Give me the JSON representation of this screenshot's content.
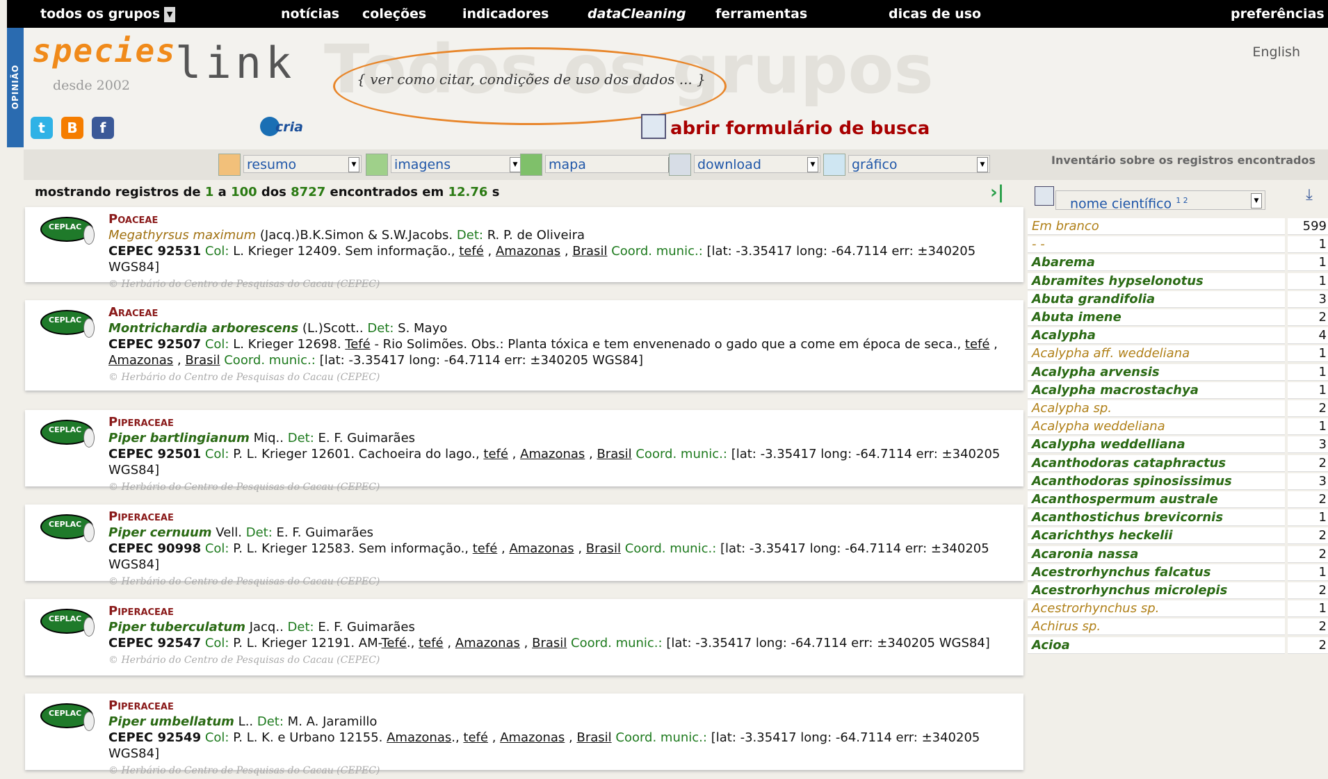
{
  "nav": {
    "group_select": "todos os grupos",
    "items": [
      "notícias",
      "coleções",
      "indicadores",
      "dataCleaning",
      "ferramentas",
      "dicas de uso",
      "preferências"
    ]
  },
  "side_tab": "OPINIÃO",
  "header": {
    "logo_species": "species",
    "logo_link": "link",
    "since": "desde 2002",
    "watermark": "Todos os grupos",
    "cite_link": "{ ver como citar, condições de uso dos dados ... }",
    "language": "English",
    "cria_label": "cria",
    "open_form": "abrir formulário de busca",
    "social": [
      "twitter-icon",
      "blogger-icon",
      "facebook-icon"
    ]
  },
  "toolbar": {
    "resumo": "resumo",
    "imagens": "imagens",
    "mapa": "mapa",
    "download": "download",
    "grafico": "gráfico",
    "inventory_title": "Inventário sobre os registros encontrados"
  },
  "summary": {
    "prefix": "mostrando registros de ",
    "from": "1",
    "sep1": " a ",
    "to": "100",
    "sep2": " dos ",
    "total": "8727",
    "sep3": " encontrados em ",
    "time": "12.76",
    "suffix": " s"
  },
  "records": [
    {
      "family": "Poaceae",
      "species": "Megathyrsus maximum",
      "species_light": true,
      "author": " (Jacq.)B.K.Simon & S.W.Jacobs.",
      "det": "R. P. de Oliveira",
      "catalog": "CEPEC 92531",
      "col_text": " L. Krieger 12409. Sem informação., ",
      "loc1": "tefé",
      "loc2": "Amazonas",
      "loc3": "Brasil",
      "coord": "[lat: -3.35417 long: -64.7114 err: ±340205 WGS84]",
      "credit": "© Herbário do Centro de Pesquisas do Cacau (CEPEC)"
    },
    {
      "family": "Araceae",
      "species": "Montrichardia arborescens",
      "species_light": false,
      "author": " (L.)Scott..",
      "det": "S. Mayo",
      "catalog": "CEPEC 92507",
      "col_text": " L. Krieger 12698. ",
      "col_u": "Tefé",
      "col_text2": " - Rio Solimões. Obs.: Planta tóxica e tem envenenado o gado que a come em época de seca., ",
      "loc1": "tefé",
      "loc2": "Amazonas",
      "loc3": "Brasil",
      "coord": "[lat: -3.35417 long: -64.7114 err: ±340205 WGS84]",
      "credit": "© Herbário do Centro de Pesquisas do Cacau (CEPEC)"
    },
    {
      "family": "Piperaceae",
      "species": "Piper bartlingianum",
      "species_light": false,
      "author": " Miq..",
      "det": "E. F. Guimarães",
      "catalog": "CEPEC 92501",
      "col_text": " P. L. Krieger 12601. Cachoeira do lago., ",
      "loc1": "tefé",
      "loc2": "Amazonas",
      "loc3": "Brasil",
      "coord": "[lat: -3.35417 long: -64.7114 err: ±340205 WGS84]",
      "credit": "© Herbário do Centro de Pesquisas do Cacau (CEPEC)"
    },
    {
      "family": "Piperaceae",
      "species": "Piper cernuum",
      "species_light": false,
      "author": " Vell.",
      "det": "E. F. Guimarães",
      "catalog": "CEPEC 90998",
      "col_text": " P. L. Krieger 12583. Sem informação., ",
      "loc1": "tefé",
      "loc2": "Amazonas",
      "loc3": "Brasil",
      "coord": "[lat: -3.35417 long: -64.7114 err: ±340205 WGS84]",
      "credit": "© Herbário do Centro de Pesquisas do Cacau (CEPEC)"
    },
    {
      "family": "Piperaceae",
      "species": "Piper tuberculatum",
      "species_light": false,
      "author": " Jacq..",
      "det": "E. F. Guimarães",
      "catalog": "CEPEC 92547",
      "col_text": " P. L. Krieger 12191. AM-",
      "col_u": "Tefé",
      "col_text2": "., ",
      "loc1": "tefé",
      "loc2": "Amazonas",
      "loc3": "Brasil",
      "coord": "[lat: -3.35417 long: -64.7114 err: ±340205 WGS84]",
      "credit": "© Herbário do Centro de Pesquisas do Cacau (CEPEC)"
    },
    {
      "family": "Piperaceae",
      "species": "Piper umbellatum",
      "species_light": false,
      "author": " L..",
      "det": "M. A. Jaramillo",
      "catalog": "CEPEC 92549",
      "col_text": " P. L. K. e Urbano 12155. ",
      "col_u": "Amazonas",
      "col_text2": "., ",
      "loc1": "tefé",
      "loc2": "Amazonas",
      "loc3": "Brasil",
      "coord": "[lat: -3.35417 long: -64.7114 err: ±340205 WGS84]",
      "credit": "© Herbário do Centro de Pesquisas do Cacau (CEPEC)"
    }
  ],
  "labels": {
    "det": "Det:",
    "col": "Col:",
    "coord": "Coord. munic.:",
    "ceplac": "CEPLAC"
  },
  "inventory": {
    "select": "nome científico",
    "select_sup": "1 2",
    "rows": [
      {
        "name": "Em branco",
        "count": "599",
        "style": "light"
      },
      {
        "name": "- -",
        "count": "1",
        "style": "light"
      },
      {
        "name": "Abarema",
        "count": "1",
        "style": "bold"
      },
      {
        "name": "Abramites hypselonotus",
        "count": "1",
        "style": "bold"
      },
      {
        "name": "Abuta grandifolia",
        "count": "3",
        "style": "bold"
      },
      {
        "name": "Abuta imene",
        "count": "2",
        "style": "bold"
      },
      {
        "name": "Acalypha",
        "count": "4",
        "style": "bold"
      },
      {
        "name": "Acalypha aff. weddeliana",
        "count": "1",
        "style": "light"
      },
      {
        "name": "Acalypha arvensis",
        "count": "1",
        "style": "bold"
      },
      {
        "name": "Acalypha macrostachya",
        "count": "1",
        "style": "bold"
      },
      {
        "name": "Acalypha sp.",
        "count": "2",
        "style": "light"
      },
      {
        "name": "Acalypha weddeliana",
        "count": "1",
        "style": "light"
      },
      {
        "name": "Acalypha weddelliana",
        "count": "3",
        "style": "bold"
      },
      {
        "name": "Acanthodoras cataphractus",
        "count": "2",
        "style": "bold"
      },
      {
        "name": "Acanthodoras spinosissimus",
        "count": "3",
        "style": "bold"
      },
      {
        "name": "Acanthospermum australe",
        "count": "2",
        "style": "bold"
      },
      {
        "name": "Acanthostichus brevicornis",
        "count": "1",
        "style": "bold"
      },
      {
        "name": "Acarichthys heckelii",
        "count": "2",
        "style": "bold"
      },
      {
        "name": "Acaronia nassa",
        "count": "2",
        "style": "bold"
      },
      {
        "name": "Acestrorhynchus falcatus",
        "count": "1",
        "style": "bold"
      },
      {
        "name": "Acestrorhynchus microlepis",
        "count": "2",
        "style": "bold"
      },
      {
        "name": "Acestrorhynchus sp.",
        "count": "1",
        "style": "light"
      },
      {
        "name": "Achirus sp.",
        "count": "2",
        "style": "light"
      },
      {
        "name": "Acioa",
        "count": "2",
        "style": "bold"
      }
    ]
  },
  "colors": {
    "accent_orange": "#e8862a",
    "green": "#2a6a14",
    "darkred": "#8a1a1a",
    "blue": "#2a6bb0"
  }
}
